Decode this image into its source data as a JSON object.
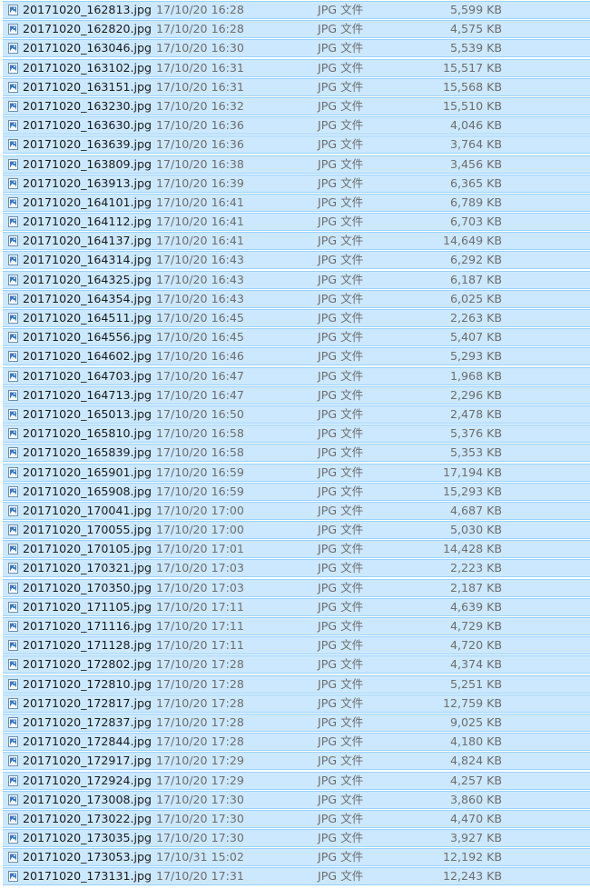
{
  "files": [
    {
      "name": "20171020_162813.jpg",
      "date": "17/10/20 16:28",
      "type": "JPG 文件",
      "size": "5,599 KB"
    },
    {
      "name": "20171020_162820.jpg",
      "date": "17/10/20 16:28",
      "type": "JPG 文件",
      "size": "4,575 KB"
    },
    {
      "name": "20171020_163046.jpg",
      "date": "17/10/20 16:30",
      "type": "JPG 文件",
      "size": "5,539 KB"
    },
    {
      "name": "20171020_163102.jpg",
      "date": "17/10/20 16:31",
      "type": "JPG 文件",
      "size": "15,517 KB"
    },
    {
      "name": "20171020_163151.jpg",
      "date": "17/10/20 16:31",
      "type": "JPG 文件",
      "size": "15,568 KB"
    },
    {
      "name": "20171020_163230.jpg",
      "date": "17/10/20 16:32",
      "type": "JPG 文件",
      "size": "15,510 KB"
    },
    {
      "name": "20171020_163630.jpg",
      "date": "17/10/20 16:36",
      "type": "JPG 文件",
      "size": "4,046 KB"
    },
    {
      "name": "20171020_163639.jpg",
      "date": "17/10/20 16:36",
      "type": "JPG 文件",
      "size": "3,764 KB"
    },
    {
      "name": "20171020_163809.jpg",
      "date": "17/10/20 16:38",
      "type": "JPG 文件",
      "size": "3,456 KB"
    },
    {
      "name": "20171020_163913.jpg",
      "date": "17/10/20 16:39",
      "type": "JPG 文件",
      "size": "6,365 KB"
    },
    {
      "name": "20171020_164101.jpg",
      "date": "17/10/20 16:41",
      "type": "JPG 文件",
      "size": "6,789 KB"
    },
    {
      "name": "20171020_164112.jpg",
      "date": "17/10/20 16:41",
      "type": "JPG 文件",
      "size": "6,703 KB"
    },
    {
      "name": "20171020_164137.jpg",
      "date": "17/10/20 16:41",
      "type": "JPG 文件",
      "size": "14,649 KB"
    },
    {
      "name": "20171020_164314.jpg",
      "date": "17/10/20 16:43",
      "type": "JPG 文件",
      "size": "6,292 KB"
    },
    {
      "name": "20171020_164325.jpg",
      "date": "17/10/20 16:43",
      "type": "JPG 文件",
      "size": "6,187 KB"
    },
    {
      "name": "20171020_164354.jpg",
      "date": "17/10/20 16:43",
      "type": "JPG 文件",
      "size": "6,025 KB"
    },
    {
      "name": "20171020_164511.jpg",
      "date": "17/10/20 16:45",
      "type": "JPG 文件",
      "size": "2,263 KB"
    },
    {
      "name": "20171020_164556.jpg",
      "date": "17/10/20 16:45",
      "type": "JPG 文件",
      "size": "5,407 KB"
    },
    {
      "name": "20171020_164602.jpg",
      "date": "17/10/20 16:46",
      "type": "JPG 文件",
      "size": "5,293 KB"
    },
    {
      "name": "20171020_164703.jpg",
      "date": "17/10/20 16:47",
      "type": "JPG 文件",
      "size": "1,968 KB"
    },
    {
      "name": "20171020_164713.jpg",
      "date": "17/10/20 16:47",
      "type": "JPG 文件",
      "size": "2,296 KB"
    },
    {
      "name": "20171020_165013.jpg",
      "date": "17/10/20 16:50",
      "type": "JPG 文件",
      "size": "2,478 KB"
    },
    {
      "name": "20171020_165810.jpg",
      "date": "17/10/20 16:58",
      "type": "JPG 文件",
      "size": "5,376 KB"
    },
    {
      "name": "20171020_165839.jpg",
      "date": "17/10/20 16:58",
      "type": "JPG 文件",
      "size": "5,353 KB"
    },
    {
      "name": "20171020_165901.jpg",
      "date": "17/10/20 16:59",
      "type": "JPG 文件",
      "size": "17,194 KB"
    },
    {
      "name": "20171020_165908.jpg",
      "date": "17/10/20 16:59",
      "type": "JPG 文件",
      "size": "15,293 KB"
    },
    {
      "name": "20171020_170041.jpg",
      "date": "17/10/20 17:00",
      "type": "JPG 文件",
      "size": "4,687 KB"
    },
    {
      "name": "20171020_170055.jpg",
      "date": "17/10/20 17:00",
      "type": "JPG 文件",
      "size": "5,030 KB"
    },
    {
      "name": "20171020_170105.jpg",
      "date": "17/10/20 17:01",
      "type": "JPG 文件",
      "size": "14,428 KB"
    },
    {
      "name": "20171020_170321.jpg",
      "date": "17/10/20 17:03",
      "type": "JPG 文件",
      "size": "2,223 KB"
    },
    {
      "name": "20171020_170350.jpg",
      "date": "17/10/20 17:03",
      "type": "JPG 文件",
      "size": "2,187 KB"
    },
    {
      "name": "20171020_171105.jpg",
      "date": "17/10/20 17:11",
      "type": "JPG 文件",
      "size": "4,639 KB"
    },
    {
      "name": "20171020_171116.jpg",
      "date": "17/10/20 17:11",
      "type": "JPG 文件",
      "size": "4,729 KB"
    },
    {
      "name": "20171020_171128.jpg",
      "date": "17/10/20 17:11",
      "type": "JPG 文件",
      "size": "4,720 KB"
    },
    {
      "name": "20171020_172802.jpg",
      "date": "17/10/20 17:28",
      "type": "JPG 文件",
      "size": "4,374 KB"
    },
    {
      "name": "20171020_172810.jpg",
      "date": "17/10/20 17:28",
      "type": "JPG 文件",
      "size": "5,251 KB"
    },
    {
      "name": "20171020_172817.jpg",
      "date": "17/10/20 17:28",
      "type": "JPG 文件",
      "size": "12,759 KB"
    },
    {
      "name": "20171020_172837.jpg",
      "date": "17/10/20 17:28",
      "type": "JPG 文件",
      "size": "9,025 KB"
    },
    {
      "name": "20171020_172844.jpg",
      "date": "17/10/20 17:28",
      "type": "JPG 文件",
      "size": "4,180 KB"
    },
    {
      "name": "20171020_172917.jpg",
      "date": "17/10/20 17:29",
      "type": "JPG 文件",
      "size": "4,824 KB"
    },
    {
      "name": "20171020_172924.jpg",
      "date": "17/10/20 17:29",
      "type": "JPG 文件",
      "size": "4,257 KB"
    },
    {
      "name": "20171020_173008.jpg",
      "date": "17/10/20 17:30",
      "type": "JPG 文件",
      "size": "3,860 KB"
    },
    {
      "name": "20171020_173022.jpg",
      "date": "17/10/20 17:30",
      "type": "JPG 文件",
      "size": "4,470 KB"
    },
    {
      "name": "20171020_173035.jpg",
      "date": "17/10/20 17:30",
      "type": "JPG 文件",
      "size": "3,927 KB"
    },
    {
      "name": "20171020_173053.jpg",
      "date": "17/10/31 15:02",
      "type": "JPG 文件",
      "size": "12,192 KB"
    },
    {
      "name": "20171020_173131.jpg",
      "date": "17/10/20 17:31",
      "type": "JPG 文件",
      "size": "12,243 KB"
    }
  ],
  "colors": {
    "selection_background": "#cce8ff",
    "selection_border": "#99d1ff",
    "name_text": "#1a1a1a",
    "detail_text": "#6d6d6d"
  },
  "icons": {
    "file": "image-file-icon"
  }
}
